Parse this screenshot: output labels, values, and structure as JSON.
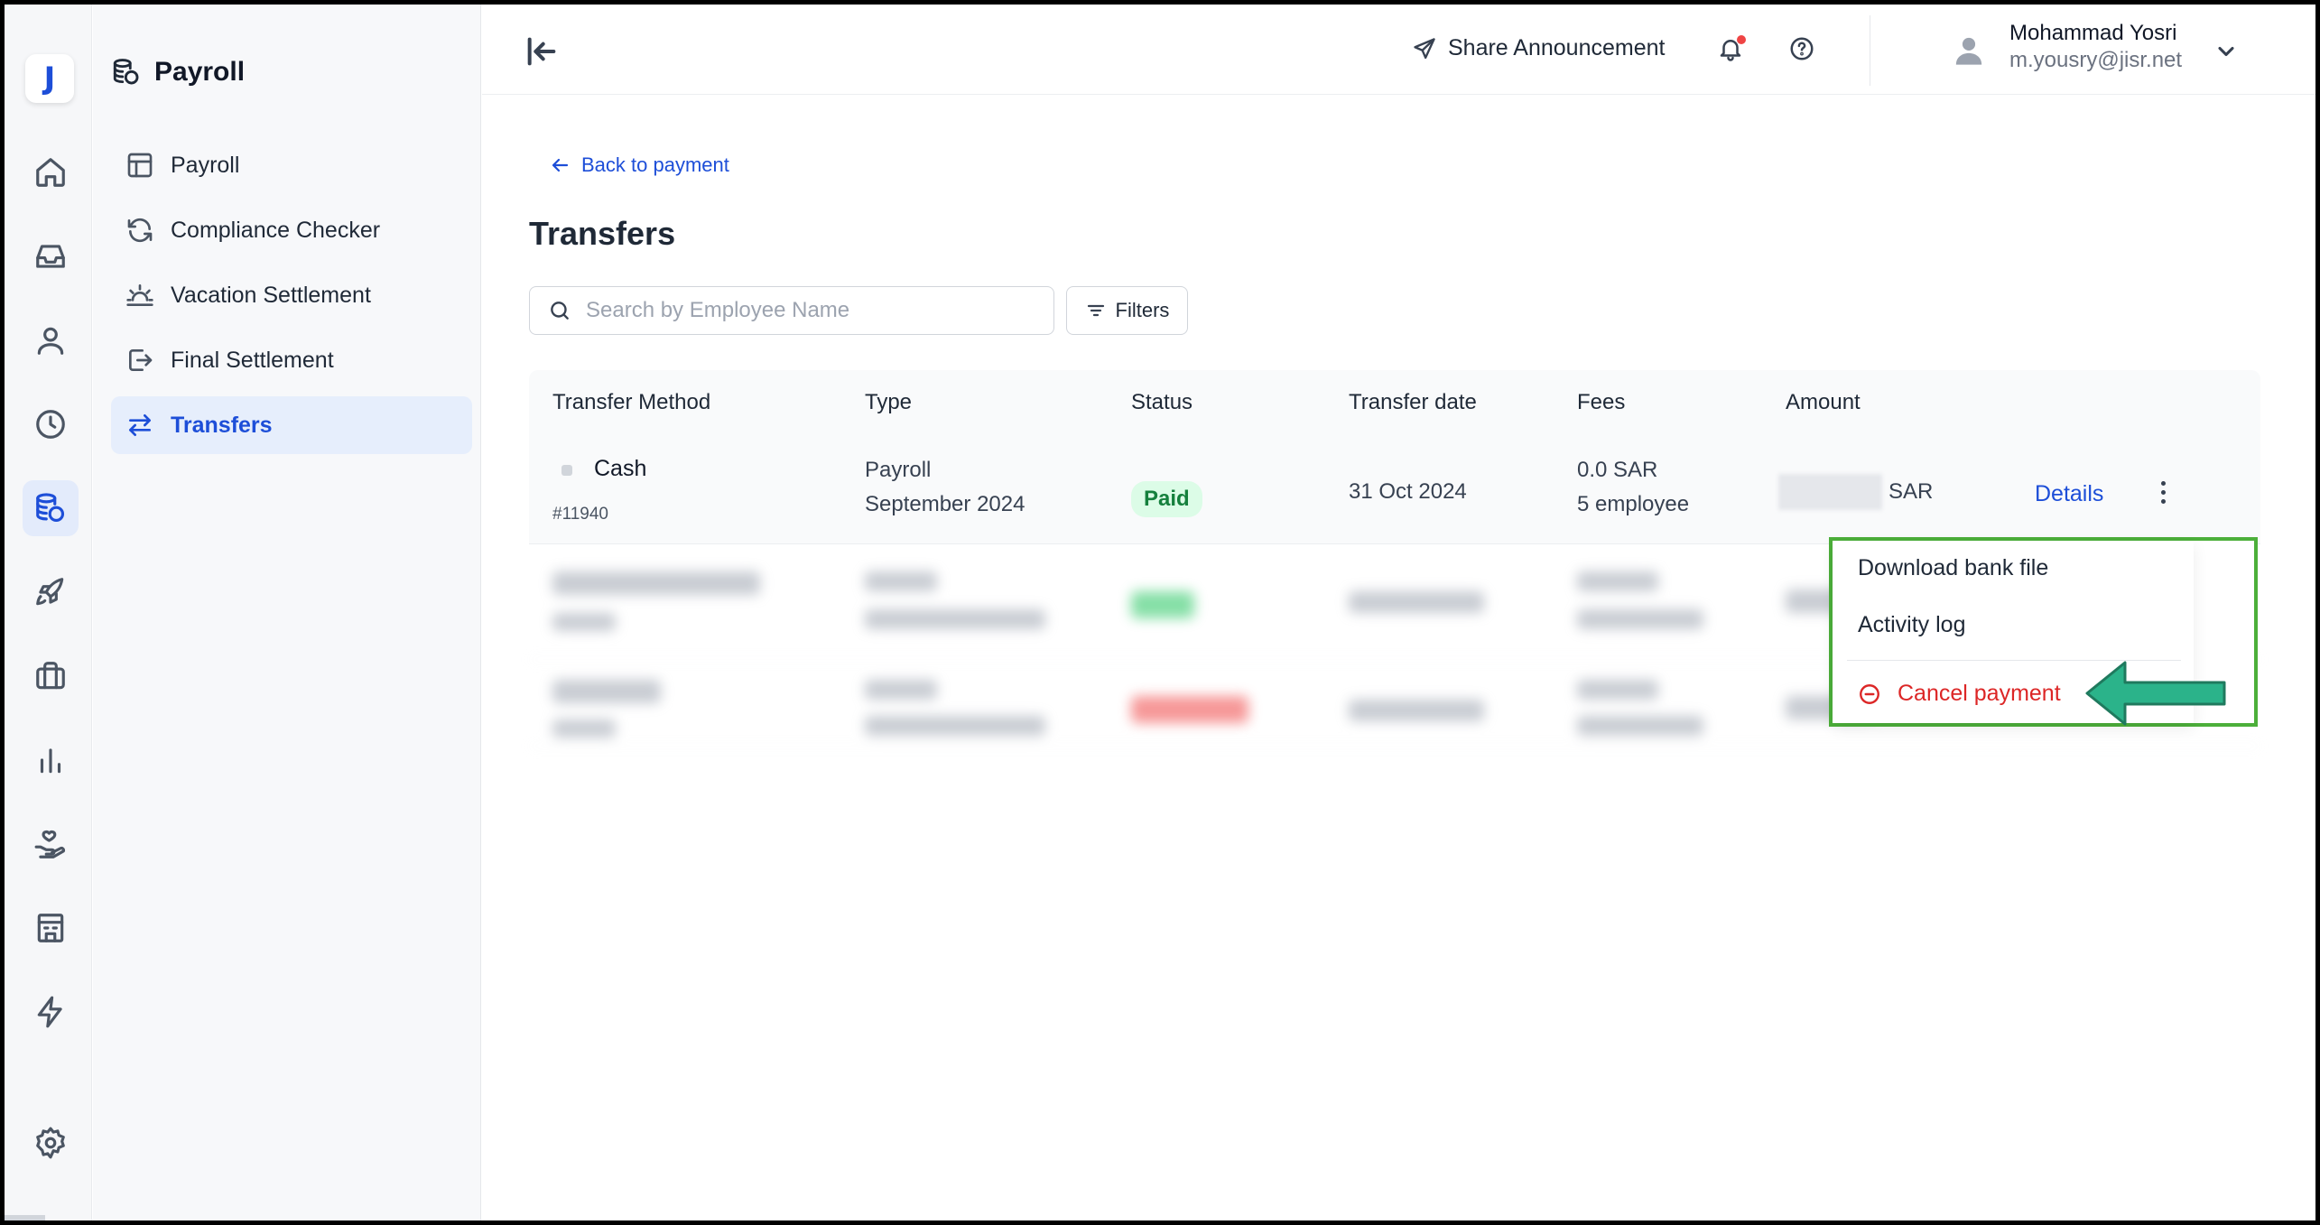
{
  "rail": {
    "logo_letter": "J",
    "icons": [
      "home-icon",
      "inbox-icon",
      "user-icon",
      "clock-icon",
      "payroll-icon",
      "rocket-icon",
      "briefcase-icon",
      "bar-chart-icon",
      "hand-heart-icon",
      "building-icon",
      "lightning-icon",
      "settings-icon"
    ],
    "active": "payroll-icon"
  },
  "subnav": {
    "title": "Payroll",
    "items": [
      {
        "label": "Payroll",
        "icon": "table-icon"
      },
      {
        "label": "Compliance Checker",
        "icon": "refresh-icon"
      },
      {
        "label": "Vacation Settlement",
        "icon": "sunrise-icon"
      },
      {
        "label": "Final Settlement",
        "icon": "logout-icon"
      },
      {
        "label": "Transfers",
        "icon": "transfer-icon",
        "active": true
      }
    ]
  },
  "topbar": {
    "share_label": "Share Announcement",
    "user_name": "Mohammad Yosri",
    "user_email": "m.yousry@jisr.net"
  },
  "main": {
    "back_label": "Back to payment",
    "title": "Transfers",
    "search_placeholder": "Search by Employee Name",
    "filters_label": "Filters"
  },
  "table": {
    "headers": [
      "Transfer Method",
      "Type",
      "Status",
      "Transfer date",
      "Fees",
      "Amount"
    ],
    "rows": [
      {
        "method": "Cash",
        "id": "#11940",
        "type_line1": "Payroll",
        "type_line2": "September 2024",
        "status": "Paid",
        "date": "31 Oct 2024",
        "fees_line1": "0.0 SAR",
        "fees_line2": "5 employee",
        "currency": "SAR",
        "details_label": "Details"
      }
    ]
  },
  "menu": {
    "items": [
      "Download bank file",
      "Activity log"
    ],
    "cancel_label": "Cancel payment"
  },
  "colors": {
    "accent": "#1d4ed8",
    "paid_bg": "#dcfce7",
    "paid_text": "#15803d",
    "danger": "#dc2626",
    "highlight_border": "#4caf3a",
    "arrow": "#2bb38a"
  }
}
